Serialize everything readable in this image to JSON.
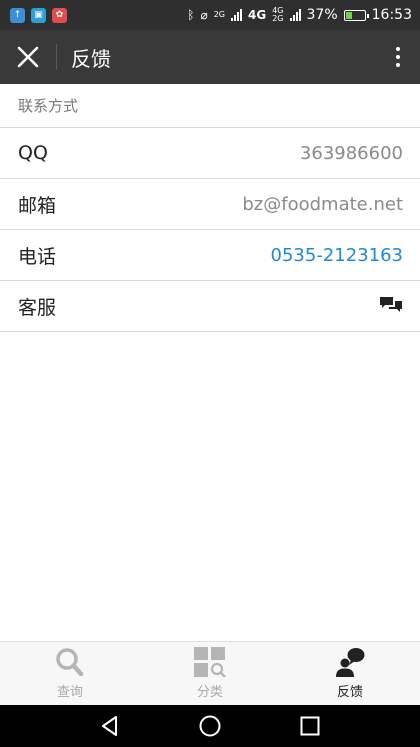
{
  "status_bar": {
    "net_small": "2G",
    "net_4g": "4G",
    "net_4g_small": "4G",
    "net_2g_small": "2G",
    "battery": "37%",
    "time": "16:53"
  },
  "app_bar": {
    "title": "反馈"
  },
  "section": {
    "label": "联系方式"
  },
  "rows": [
    {
      "label": "QQ",
      "value": "363986600"
    },
    {
      "label": "邮箱",
      "value": "bz@foodmate.net"
    },
    {
      "label": "电话",
      "value": "0535-2123163"
    },
    {
      "label": "客服",
      "icon": "chat-icon"
    }
  ],
  "bottom_nav": [
    {
      "label": "查询",
      "icon": "search-icon"
    },
    {
      "label": "分类",
      "icon": "category-icon"
    },
    {
      "label": "反馈",
      "icon": "feedback-icon",
      "active": true
    }
  ],
  "colors": {
    "app_bar": "#393939",
    "link": "#1f8ad6",
    "battery_fill": "#6ed34f"
  }
}
